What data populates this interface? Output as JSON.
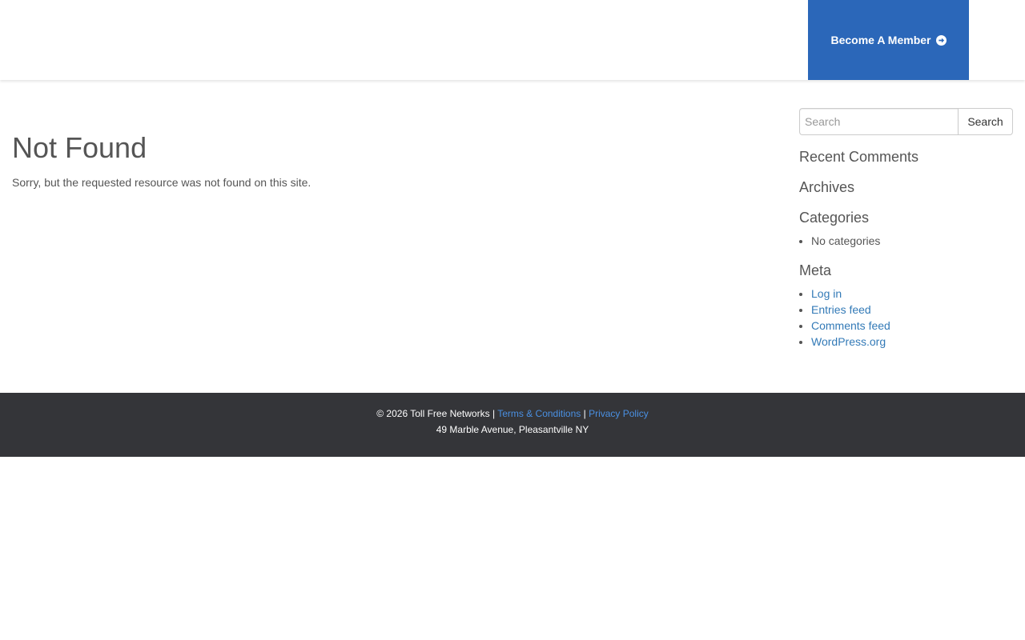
{
  "header": {
    "member_button_label": "Become A Member",
    "member_button_color": "#2b67b9",
    "member_button_icon": "arrow-circle-right-icon"
  },
  "main": {
    "title": "Not Found",
    "message": "Sorry, but the requested resource was not found on this site."
  },
  "sidebar": {
    "search": {
      "placeholder": "Search",
      "value": "",
      "button_label": "Search"
    },
    "recent_comments_title": "Recent Comments",
    "archives_title": "Archives",
    "categories_title": "Categories",
    "categories_items": [
      "No categories"
    ],
    "meta_title": "Meta",
    "meta_links": [
      "Log in",
      "Entries feed",
      "Comments feed",
      "WordPress.org"
    ],
    "link_color": "#337ab7"
  },
  "footer": {
    "copyright": "© 2026 Toll Free Networks",
    "separator": "|",
    "terms_label": "Terms & Conditions",
    "privacy_label": "Privacy Policy",
    "address": "49 Marble Avenue, Pleasantville NY",
    "background_color": "#343539"
  }
}
